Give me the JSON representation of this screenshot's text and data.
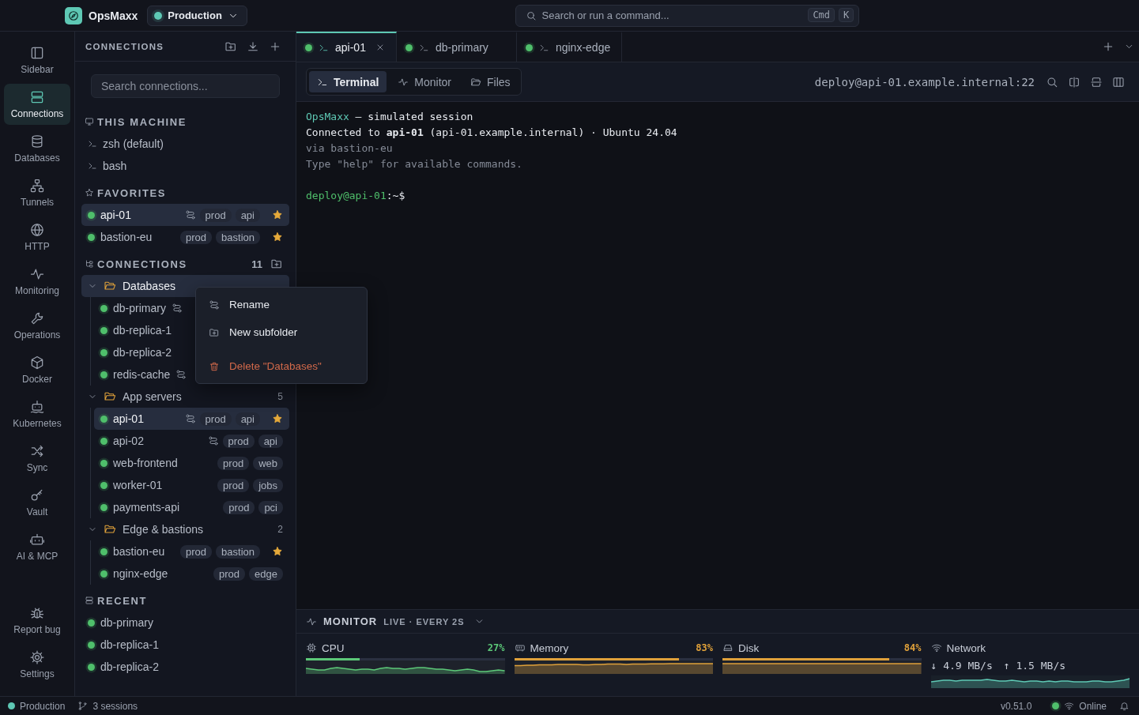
{
  "app": {
    "name": "OpsMaxx",
    "environment": {
      "label": "Production",
      "color": "#5ec8b4"
    }
  },
  "command_search": {
    "placeholder": "Search or run a command...",
    "keys": [
      "Cmd",
      "K"
    ]
  },
  "rail": {
    "items": [
      {
        "label": "Sidebar",
        "selected": false
      },
      {
        "label": "Connections",
        "selected": true
      },
      {
        "label": "Databases",
        "selected": false
      },
      {
        "label": "Tunnels",
        "selected": false
      },
      {
        "label": "HTTP",
        "selected": false
      },
      {
        "label": "Monitoring",
        "selected": false
      },
      {
        "label": "Operations",
        "selected": false
      },
      {
        "label": "Docker",
        "selected": false
      },
      {
        "label": "Kubernetes",
        "selected": false
      },
      {
        "label": "Sync",
        "selected": false
      },
      {
        "label": "Vault",
        "selected": false
      },
      {
        "label": "AI & MCP",
        "selected": false
      }
    ],
    "footer_items": [
      {
        "label": "Report bug",
        "selected": false
      },
      {
        "label": "Settings",
        "selected": false
      }
    ]
  },
  "sidebar": {
    "title": "CONNECTIONS",
    "search": {
      "placeholder": "Search connections..."
    },
    "this_machine": {
      "title": "THIS MACHINE",
      "shells": [
        {
          "name": "zsh (default)"
        },
        {
          "name": "bash"
        }
      ]
    },
    "favorites": {
      "title": "FAVORITES",
      "items": [
        {
          "name": "api-01",
          "online": true,
          "linked": true,
          "tags": [
            "prod",
            "api"
          ],
          "favorite": true,
          "selected": true
        },
        {
          "name": "bastion-eu",
          "online": true,
          "linked": false,
          "tags": [
            "prod",
            "bastion"
          ],
          "favorite": true,
          "selected": false
        }
      ]
    },
    "connections": {
      "title": "CONNECTIONS",
      "count": "11",
      "folders": [
        {
          "name": "Databases",
          "expanded": true,
          "selected": true,
          "children": [
            {
              "name": "db-primary",
              "online": true,
              "linked": true,
              "selected": false
            },
            {
              "name": "db-replica-1",
              "online": true,
              "linked": false,
              "selected": false
            },
            {
              "name": "db-replica-2",
              "online": true,
              "linked": false,
              "selected": false
            },
            {
              "name": "redis-cache",
              "online": true,
              "linked": true,
              "selected": false
            }
          ]
        },
        {
          "name": "App servers",
          "count": "5",
          "expanded": true,
          "selected": false,
          "children": [
            {
              "name": "api-01",
              "online": true,
              "linked": true,
              "tags": [
                "prod",
                "api"
              ],
              "favorite": true,
              "selected": true
            },
            {
              "name": "api-02",
              "online": true,
              "linked": true,
              "tags": [
                "prod",
                "api"
              ],
              "favorite": false,
              "selected": false
            },
            {
              "name": "web-frontend",
              "online": true,
              "linked": false,
              "tags": [
                "prod",
                "web"
              ],
              "favorite": false,
              "selected": false
            },
            {
              "name": "worker-01",
              "online": true,
              "linked": false,
              "tags": [
                "prod",
                "jobs"
              ],
              "favorite": false,
              "selected": false
            },
            {
              "name": "payments-api",
              "online": true,
              "linked": false,
              "tags": [
                "prod",
                "pci"
              ],
              "favorite": false,
              "selected": false
            }
          ]
        },
        {
          "name": "Edge & bastions",
          "count": "2",
          "expanded": true,
          "selected": false,
          "children": [
            {
              "name": "bastion-eu",
              "online": true,
              "linked": false,
              "tags": [
                "prod",
                "bastion"
              ],
              "favorite": true,
              "selected": false
            },
            {
              "name": "nginx-edge",
              "online": true,
              "linked": false,
              "tags": [
                "prod",
                "edge"
              ],
              "favorite": false,
              "selected": false
            }
          ]
        }
      ]
    },
    "recent": {
      "title": "RECENT",
      "items": [
        {
          "name": "db-primary",
          "online": true
        },
        {
          "name": "db-replica-1",
          "online": true
        },
        {
          "name": "db-replica-2",
          "online": true
        }
      ]
    }
  },
  "tabs": [
    {
      "label": "api-01",
      "online": true,
      "selected": true,
      "closable": true
    },
    {
      "label": "db-primary",
      "online": true,
      "selected": false,
      "closable": false
    },
    {
      "label": "nginx-edge",
      "online": true,
      "selected": false,
      "closable": false
    }
  ],
  "view_tabs": [
    {
      "label": "Terminal",
      "selected": true
    },
    {
      "label": "Monitor",
      "selected": false
    },
    {
      "label": "Files",
      "selected": false
    }
  ],
  "session": {
    "host": "deploy@api-01.example.internal:22"
  },
  "terminal": {
    "lines": [
      {
        "kind": "output",
        "parts": [
          {
            "text": "OpsMaxx",
            "kind": "accent"
          },
          {
            "text": " — simulated session",
            "kind": "plain"
          }
        ]
      },
      {
        "kind": "output",
        "parts": [
          {
            "text": "Connected to **api-01** (api-01.example.internal) · Ubuntu 24.04",
            "kind": "plain"
          }
        ]
      },
      {
        "kind": "output",
        "parts": [
          {
            "text": "via bastion-eu",
            "kind": "muted"
          }
        ]
      },
      {
        "kind": "output",
        "parts": [
          {
            "text": "Type \"help\" for available commands.",
            "kind": "muted"
          }
        ]
      },
      {
        "kind": "prompt",
        "parts": [
          {
            "text": "deploy@api-01",
            "kind": "prompt"
          },
          {
            "text": ":~$",
            "kind": "plain"
          }
        ]
      }
    ]
  },
  "monitor": {
    "title": "MONITOR",
    "subtitle": "LIVE · EVERY 2S",
    "metrics": [
      {
        "kind": "gauge",
        "label": "CPU",
        "reading": "27%",
        "level": 0.27,
        "color": "#5cc878"
      },
      {
        "kind": "gauge",
        "label": "Memory",
        "reading": "83%",
        "level": 0.83,
        "color": "#e0a13a"
      },
      {
        "kind": "gauge",
        "label": "Disk",
        "reading": "84%",
        "level": 0.84,
        "color": "#e0a13a"
      },
      {
        "kind": "throughput",
        "label": "Network",
        "readings": [
          "↓ 4.9 MB/s",
          "↑ 1.5 MB/s"
        ],
        "color": "#5ec8b4"
      }
    ]
  },
  "context_menu": {
    "items": [
      {
        "label": "Rename",
        "kind": "normal"
      },
      {
        "label": "New subfolder",
        "kind": "normal"
      },
      {
        "label": "Delete \"Databases\"",
        "kind": "danger"
      }
    ]
  },
  "status_bar": {
    "environment": {
      "label": "Production",
      "color": "#5ec8b4"
    },
    "sessions": "3 sessions",
    "version": "v0.51.0",
    "connection": {
      "label": "Online",
      "online": true
    }
  }
}
